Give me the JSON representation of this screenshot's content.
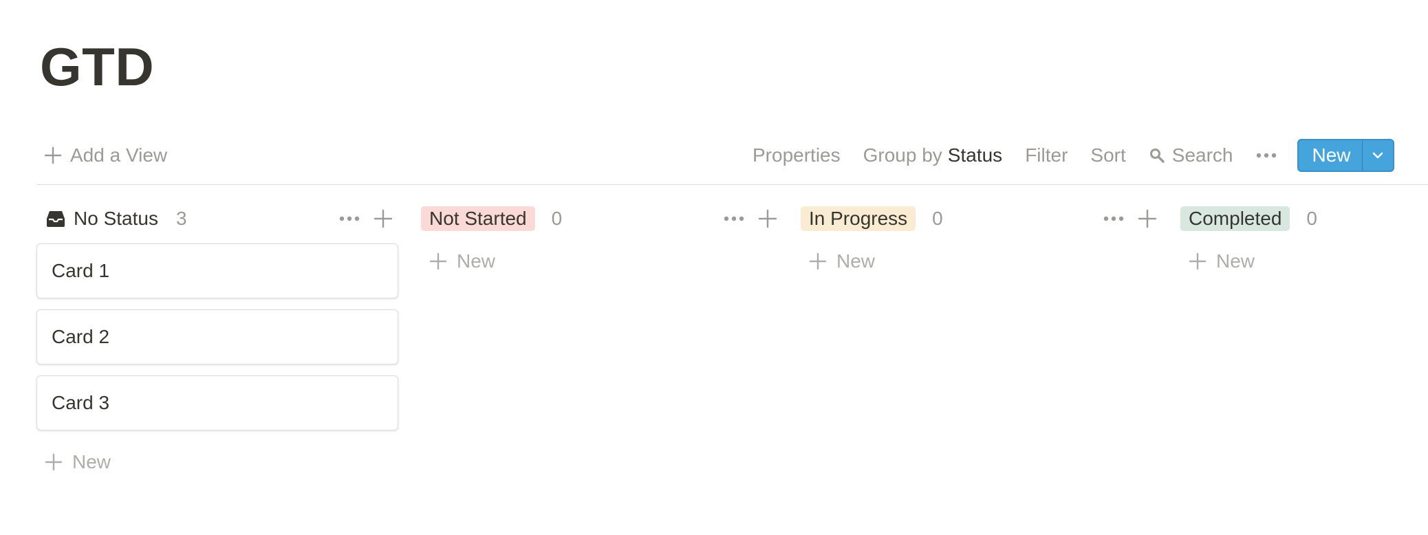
{
  "page": {
    "title": "GTD"
  },
  "toolbar": {
    "add_view_label": "Add a View",
    "properties_label": "Properties",
    "group_by_label": "Group by",
    "group_by_value": "Status",
    "filter_label": "Filter",
    "sort_label": "Sort",
    "search_label": "Search",
    "more_icon": "ellipsis-icon",
    "new_label": "New",
    "accent_color": "#46a4dc"
  },
  "columns": [
    {
      "title": "No Status",
      "count": "3",
      "icon": "inbox-icon",
      "tag_color": null,
      "cards": [
        "Card 1",
        "Card 2",
        "Card 3"
      ],
      "new_label": "New"
    },
    {
      "title": "Not Started",
      "count": "0",
      "tag_color": "#fbd9d6",
      "cards": [],
      "new_label": "New"
    },
    {
      "title": "In Progress",
      "count": "0",
      "tag_color": "#f9ecd3",
      "cards": [],
      "new_label": "New"
    },
    {
      "title": "Completed",
      "count": "0",
      "tag_color": "#d8e8e1",
      "cards": [],
      "new_label": "New"
    }
  ]
}
